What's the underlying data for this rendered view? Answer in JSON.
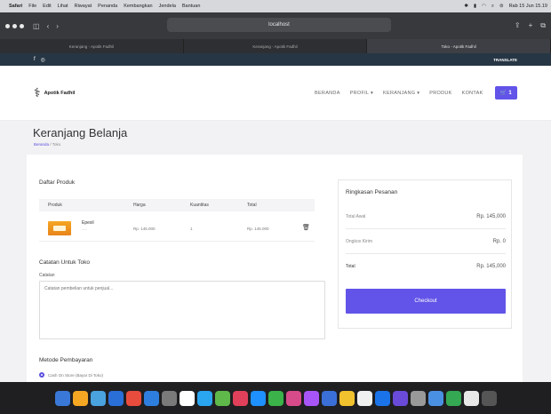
{
  "menubar": {
    "app": "Safari",
    "items": [
      "File",
      "Edit",
      "Lihat",
      "Riwayat",
      "Penanda",
      "Kembangkan",
      "Jendela",
      "Bantuan"
    ],
    "clock": "Rab 15 Jun 15.19"
  },
  "toolbar": {
    "address": "localhost"
  },
  "tabs": [
    "Keranjang - Apotik Fadhil",
    "Keranjang - Apotik Fadhil",
    "Toko - Apotik Fadhil"
  ],
  "sitebar": {
    "lang": "TRANSLATE"
  },
  "header": {
    "logo_text": "Apotik Fadhil",
    "nav": [
      "BERANDA",
      "PROFIL ▾",
      "KERANJANG ▾",
      "PRODUK",
      "KONTAK"
    ],
    "cart_label": "🛒 1"
  },
  "page": {
    "title": "Keranjang Belanja",
    "breadcrumb_home": "Beranda",
    "breadcrumb_sep": "/",
    "breadcrumb_current": "Toko"
  },
  "products": {
    "title": "Daftar Produk",
    "headers": [
      "Produk",
      "Harga",
      "Kuantitas",
      "Total"
    ],
    "rows": [
      {
        "name": "Epexil",
        "sub": "-----",
        "price": "Rp. 145.000",
        "qty": "1",
        "total": "Rp. 145.000"
      }
    ]
  },
  "notes": {
    "title": "Catatan Untuk Toko",
    "label": "Catatan",
    "placeholder": "Catatan pembelian untuk penjual..."
  },
  "payment": {
    "title": "Metode Pembayaran",
    "option": "Cash On Store (Bayar Di Toko)"
  },
  "summary": {
    "title": "Ringkasan Pesanan",
    "rows": [
      {
        "label": "Total Awal",
        "value": "Rp. 145,000"
      },
      {
        "label": "Ongkos Kirim",
        "value": "Rp. 0"
      },
      {
        "label": "Total",
        "value": "Rp. 145,000"
      }
    ],
    "checkout_label": "Checkout"
  },
  "dock": {
    "colors": [
      "#3a78d8",
      "#f5a623",
      "#4aa3df",
      "#2a6ed8",
      "#e84c3d",
      "#2e7ee0",
      "#7a7a7a",
      "#ffffff",
      "#2aa5f0",
      "#5fb84a",
      "#e0405a",
      "#1e90ff",
      "#3bb34a",
      "#d84b8a",
      "#a855f7",
      "#3a6fd8",
      "#f2c12e",
      "#f0f0f0",
      "#1a73e8",
      "#6a4ad8",
      "#999999",
      "#4a90e2",
      "#34a853",
      "#e8e8e8",
      "#555555"
    ]
  }
}
